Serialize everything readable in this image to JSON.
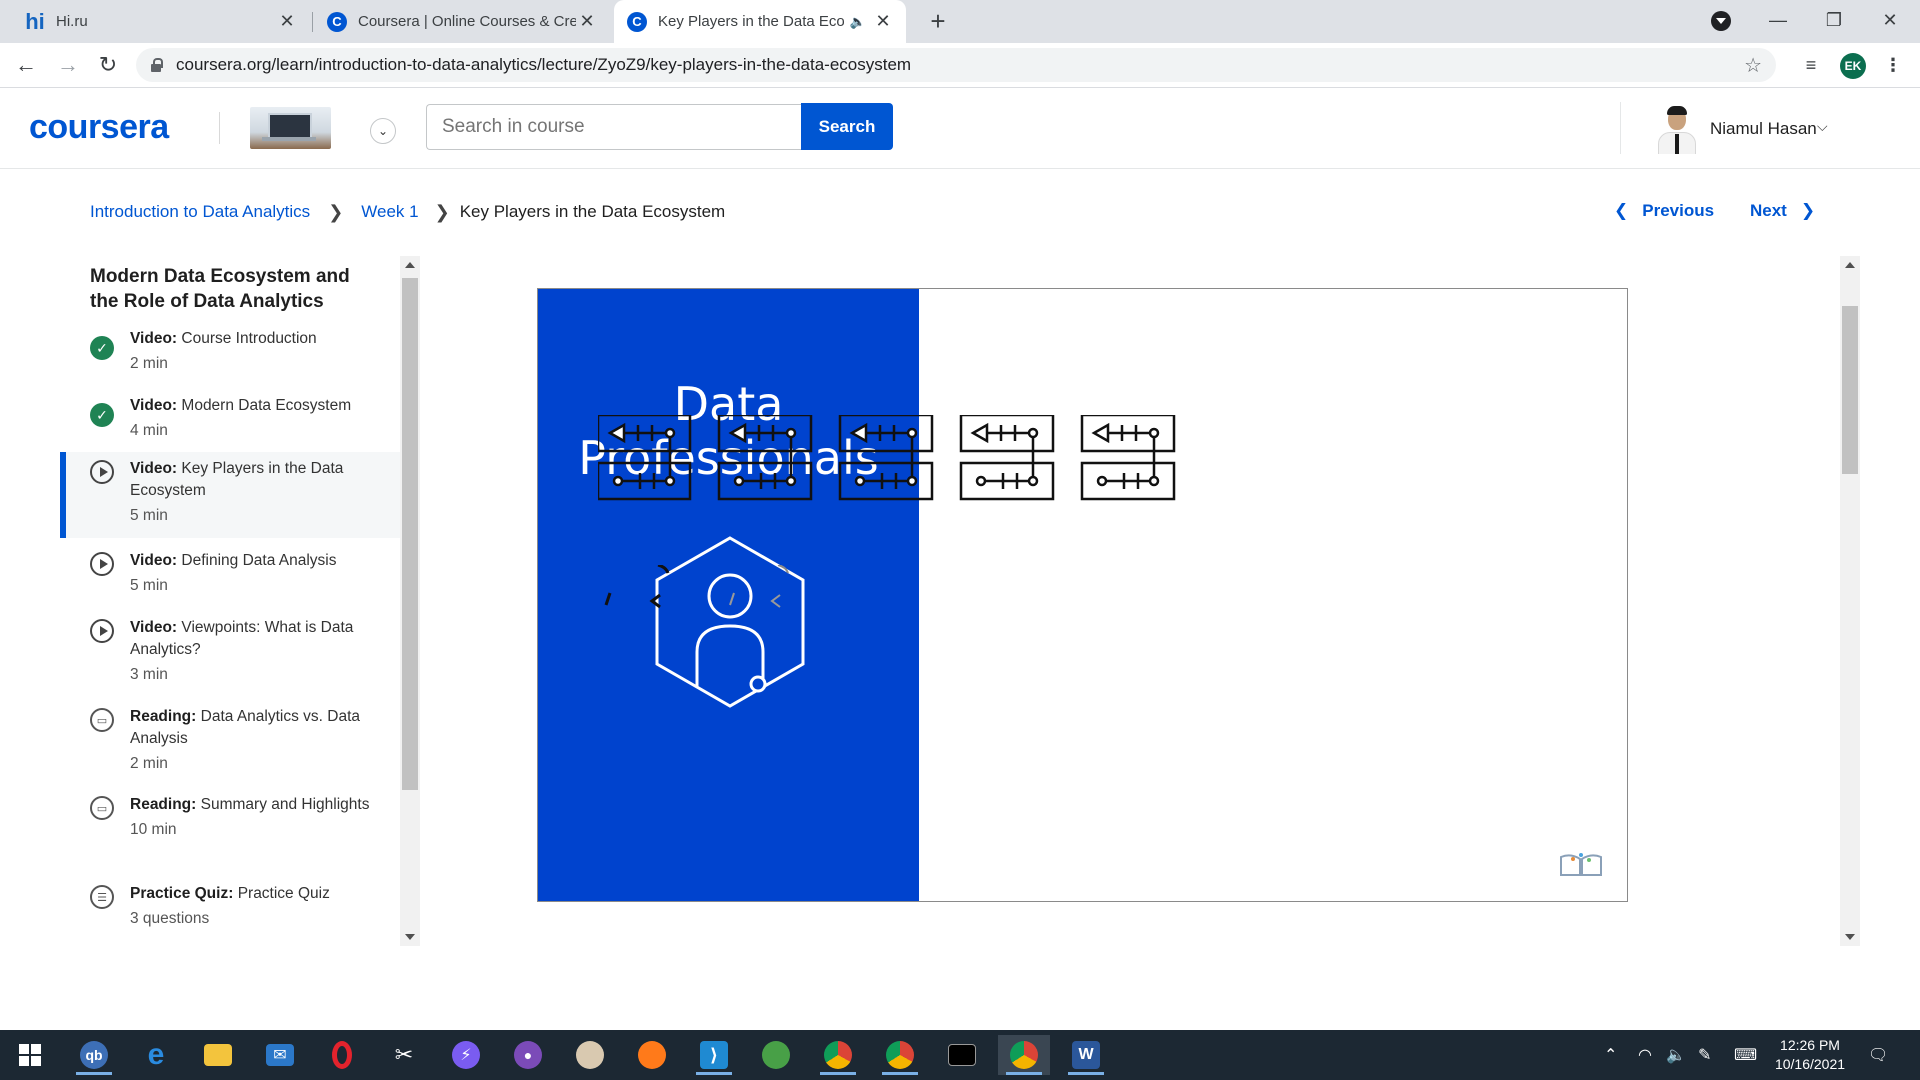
{
  "browser": {
    "tabs": [
      {
        "title": "Hi.ru",
        "favicon": "hi"
      },
      {
        "title": "Coursera | Online Courses & Credentials",
        "favicon": "C"
      },
      {
        "title": "Key Players in the Data Ecosystem",
        "favicon": "C"
      }
    ],
    "url": "coursera.org/learn/introduction-to-data-analytics/lecture/ZyoZ9/key-players-in-the-data-ecosystem",
    "profile_initials": "EK"
  },
  "header": {
    "logo": "coursera",
    "search_placeholder": "Search in course",
    "search_button": "Search",
    "user_name": "Niamul Hasan"
  },
  "breadcrumb": {
    "course": "Introduction to Data Analytics",
    "week": "Week 1",
    "current": "Key Players in the Data Ecosystem"
  },
  "nav": {
    "previous": "Previous",
    "next": "Next"
  },
  "sidebar": {
    "module_title": "Modern Data Ecosystem and the Role of Data Analytics",
    "items": [
      {
        "type": "Video:",
        "title": "Course Introduction",
        "duration": "2 min",
        "status": "done"
      },
      {
        "type": "Video:",
        "title": "Modern Data Ecosystem",
        "duration": "4 min",
        "status": "done"
      },
      {
        "type": "Video:",
        "title": "Key Players in the Data Ecosystem",
        "duration": "5 min",
        "status": "active"
      },
      {
        "type": "Video:",
        "title": "Defining Data Analysis",
        "duration": "5 min",
        "status": "todo"
      },
      {
        "type": "Video:",
        "title": "Viewpoints: What is Data Analytics?",
        "duration": "3 min",
        "status": "todo"
      },
      {
        "type": "Reading:",
        "title": "Data Analytics vs. Data Analysis",
        "duration": "2 min",
        "status": "todo"
      },
      {
        "type": "Reading:",
        "title": "Summary and Highlights",
        "duration": "10 min",
        "status": "todo"
      },
      {
        "type": "Practice Quiz:",
        "title": "Practice Quiz",
        "duration": "3 questions",
        "status": "todo"
      }
    ]
  },
  "video": {
    "slide_title": "Data Professionals",
    "panel_color": "#0043ce"
  },
  "taskbar": {
    "time": "12:26 PM",
    "date": "10/16/2021"
  },
  "colors": {
    "accent": "#0056d2",
    "done": "#1f8354"
  }
}
